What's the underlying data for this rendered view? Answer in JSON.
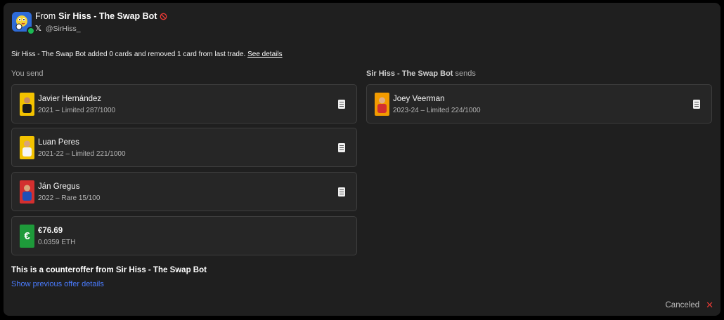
{
  "header": {
    "from_prefix": "From",
    "sender_name": "Sir Hiss - The Swap Bot",
    "handle": "@SirHiss_"
  },
  "notice": {
    "text": "Sir Hiss - The Swap Bot added 0 cards and removed 1 card from last trade.",
    "link_label": "See details"
  },
  "you_send": {
    "heading": "You send",
    "cards": [
      {
        "name": "Javier Hernández",
        "detail": "2021 – Limited 287/1000",
        "thumb_color": "#f2c200"
      },
      {
        "name": "Luan Peres",
        "detail": "2021-22 – Limited 221/1000",
        "thumb_color": "#f2c200"
      },
      {
        "name": "Ján Gregus",
        "detail": "2022 – Rare 15/100",
        "thumb_color": "#d32f2f"
      }
    ],
    "currency": {
      "symbol": "€",
      "amount": "€76.69",
      "eth": "0.0359 ETH",
      "color": "#1e9a3a"
    }
  },
  "they_send": {
    "heading_name": "Sir Hiss - The Swap Bot",
    "heading_suffix": "sends",
    "cards": [
      {
        "name": "Joey Veerman",
        "detail": "2023-24 – Limited 224/1000",
        "thumb_color": "#f29b00"
      }
    ]
  },
  "footer": {
    "counteroffer_text": "This is a counteroffer from Sir Hiss - The Swap Bot",
    "previous_link": "Show previous offer details",
    "status": "Canceled"
  },
  "colors": {
    "link_blue": "#4a7cff",
    "cancel_red": "#e53935",
    "online_green": "#1db954"
  }
}
